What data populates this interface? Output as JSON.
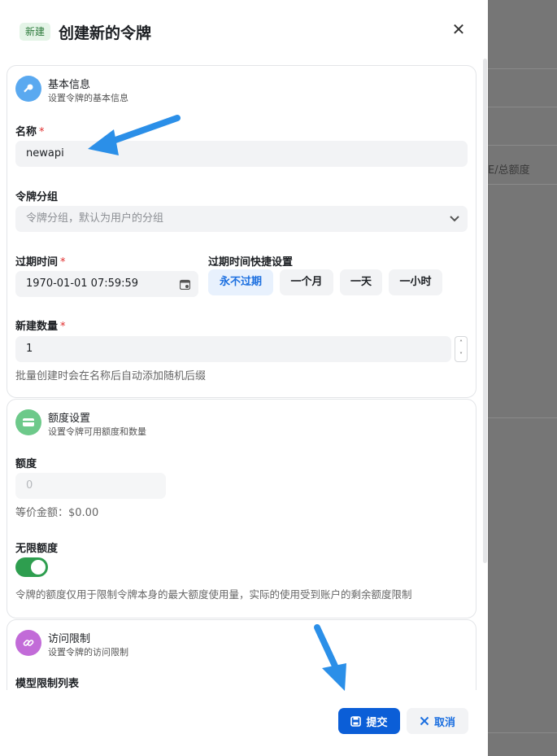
{
  "dialog": {
    "tag": "新建",
    "title": "创建新的令牌",
    "close_label": "✕"
  },
  "basic": {
    "title": "基本信息",
    "subtitle": "设置令牌的基本信息",
    "name_label": "名称",
    "name_value": "newapi",
    "group_label": "令牌分组",
    "group_placeholder": "令牌分组，默认为用户的分组",
    "expire_label": "过期时间",
    "expire_value": "1970-01-01 07:59:59",
    "quick_label": "过期时间快捷设置",
    "quick_options": [
      "永不过期",
      "一个月",
      "一天",
      "一小时"
    ],
    "count_label": "新建数量",
    "count_value": "1",
    "count_hint": "批量创建时会在名称后自动添加随机后缀"
  },
  "quota": {
    "title": "额度设置",
    "subtitle": "设置令牌可用额度和数量",
    "amount_label": "额度",
    "amount_placeholder": "0",
    "equivalent": "等价金额：$0.00",
    "unlimited_label": "无限额度",
    "unlimited_on": true,
    "note": "令牌的额度仅用于限制令牌本身的最大额度使用量，实际的使用受到账户的剩余额度限制"
  },
  "access": {
    "title": "访问限制",
    "subtitle": "设置令牌的访问限制",
    "model_list_label": "模型限制列表"
  },
  "footer": {
    "submit_label": "提交",
    "cancel_label": "取消"
  },
  "background": {
    "column_text": "E/总额度"
  },
  "colors": {
    "primary": "#0b5ed7",
    "toggle_on": "#2e9e4f",
    "arrow": "#2b8fe8"
  }
}
